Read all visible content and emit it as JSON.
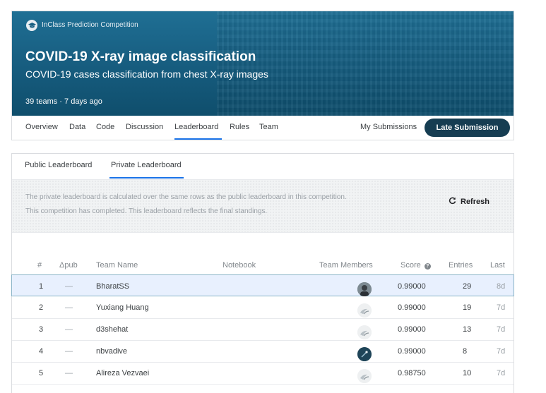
{
  "competition": {
    "type_label": "InClass Prediction Competition",
    "title": "COVID-19 X-ray image classification",
    "subtitle": "COVID-19 cases classification from chest X-ray images",
    "meta": "39 teams · 7 days ago"
  },
  "nav": {
    "tabs": [
      "Overview",
      "Data",
      "Code",
      "Discussion",
      "Leaderboard",
      "Rules",
      "Team"
    ],
    "active_tab": "Leaderboard",
    "my_submissions": "My Submissions",
    "late_submission": "Late Submission"
  },
  "leaderboard": {
    "tabs": [
      "Public Leaderboard",
      "Private Leaderboard"
    ],
    "active_tab": "Private Leaderboard",
    "info_line1": "The private leaderboard is calculated over the same rows as the public leaderboard in this competition.",
    "info_line2": "This competition has completed. This leaderboard reflects the final standings.",
    "refresh_label": "Refresh",
    "columns": [
      "#",
      "Δpub",
      "Team Name",
      "Notebook",
      "Team Members",
      "Score",
      "Entries",
      "Last"
    ],
    "rows": [
      {
        "rank": "1",
        "delta": "—",
        "team": "BharatSS",
        "score": "0.99000",
        "entries": "29",
        "last": "8d",
        "avatar": "photo"
      },
      {
        "rank": "2",
        "delta": "—",
        "team": "Yuxiang Huang",
        "score": "0.99000",
        "entries": "19",
        "last": "7d",
        "avatar": "default"
      },
      {
        "rank": "3",
        "delta": "—",
        "team": "d3shehat",
        "score": "0.99000",
        "entries": "13",
        "last": "7d",
        "avatar": "default"
      },
      {
        "rank": "4",
        "delta": "—",
        "team": "nbvadive",
        "score": "0.99000",
        "entries": "8",
        "last": "7d",
        "avatar": "dark"
      },
      {
        "rank": "5",
        "delta": "—",
        "team": "Alireza Vezvaei",
        "score": "0.98750",
        "entries": "10",
        "last": "7d",
        "avatar": "default"
      }
    ]
  },
  "colors": {
    "banner": "#185f82",
    "late_button": "#163d52",
    "accent": "#1a73e8",
    "highlight_row": "#e8f0fe"
  },
  "icons": {
    "competition_type": "graduation-cap-icon",
    "refresh": "refresh-icon",
    "score_help": "help-circle-icon"
  }
}
